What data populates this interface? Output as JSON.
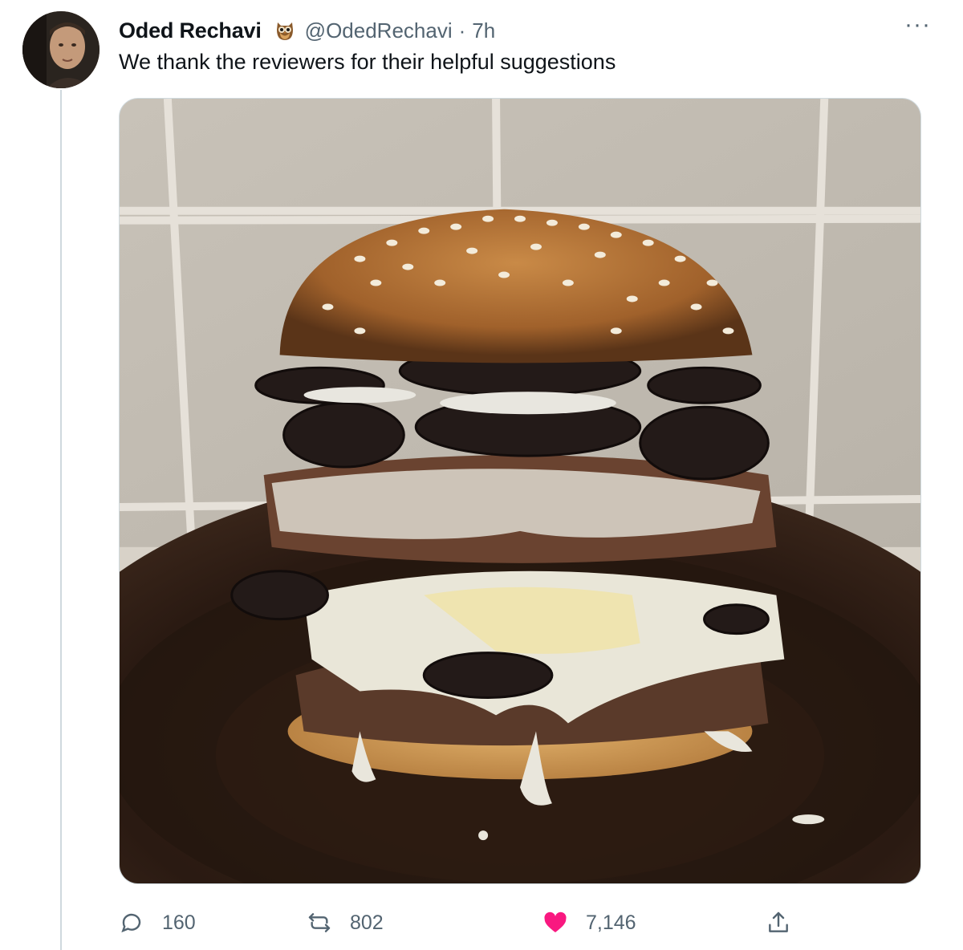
{
  "tweet": {
    "display_name": "Oded Rechavi",
    "handle": "@OdedRechavi",
    "separator": "·",
    "time": "7h",
    "text": "We thank the reviewers for their helpful suggestions",
    "more_label": "···"
  },
  "icons": {
    "verified_badge": "owl-icon",
    "reply": "reply-icon",
    "retweet": "retweet-icon",
    "like": "heart-icon",
    "share": "share-icon",
    "more": "more-icon"
  },
  "stats": {
    "replies": "160",
    "retweets": "802",
    "likes": "7,146"
  },
  "colors": {
    "text_primary": "#0f1419",
    "text_secondary": "#536471",
    "like_pink": "#f91880",
    "border": "#cfd9de"
  },
  "media": {
    "kind": "photo"
  }
}
